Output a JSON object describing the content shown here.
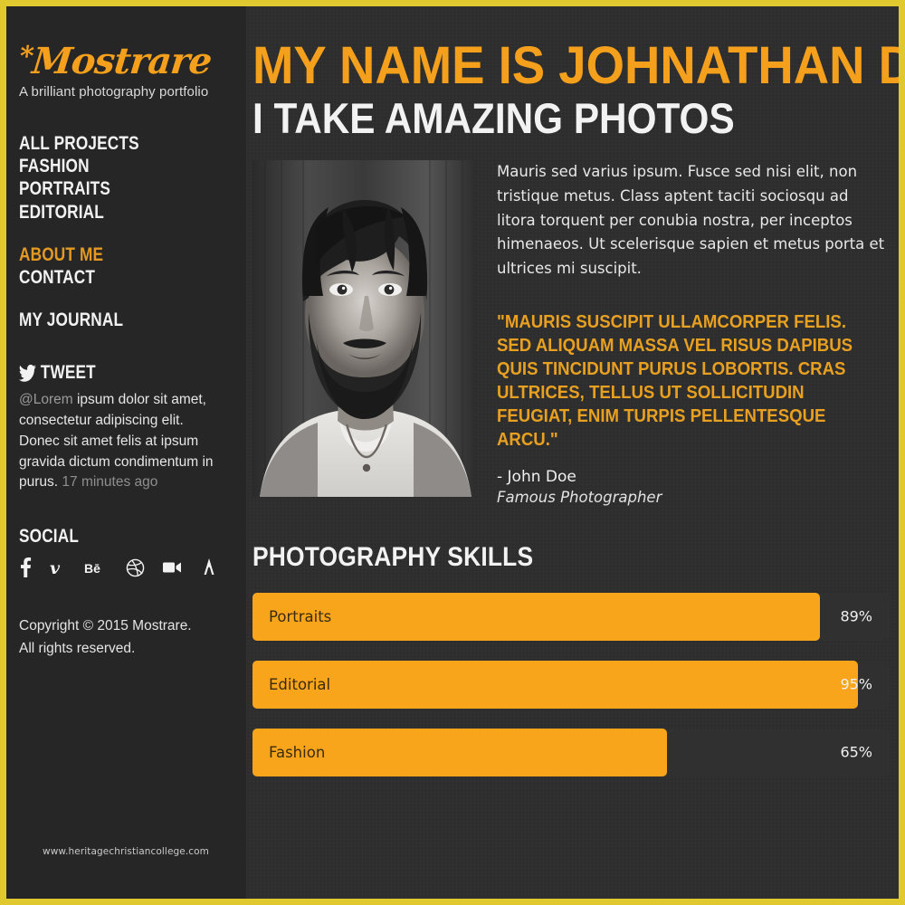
{
  "brand": {
    "logo_star": "*",
    "logo_text": "Mostrare",
    "tagline": "A brilliant photography portfolio"
  },
  "sidebar": {
    "nav_groups": [
      {
        "items": [
          {
            "label": "ALL PROJECTS",
            "active": false
          },
          {
            "label": "FASHION",
            "active": false
          },
          {
            "label": "PORTRAITS",
            "active": false
          },
          {
            "label": "EDITORIAL",
            "active": false
          }
        ]
      },
      {
        "items": [
          {
            "label": "ABOUT ME",
            "active": true
          },
          {
            "label": "CONTACT",
            "active": false
          }
        ]
      },
      {
        "items": [
          {
            "label": "MY JOURNAL",
            "active": false
          }
        ]
      }
    ],
    "tweet": {
      "heading": "TWEET",
      "icon": "twitter-bird-icon",
      "handle": "@Lorem",
      "text": " ipsum dolor sit amet, consectetur adipiscing elit. Donec sit amet felis at ipsum gravida dictum condimentum in purus. ",
      "timestamp": "17 minutes ago"
    },
    "social": {
      "heading": "SOCIAL",
      "icons": [
        {
          "name": "facebook-icon",
          "glyph": "f"
        },
        {
          "name": "vimeo-icon",
          "glyph": "v"
        },
        {
          "name": "behance-icon",
          "glyph": "Bē"
        },
        {
          "name": "dribbble-icon",
          "glyph": "ball"
        },
        {
          "name": "vine-video-icon",
          "glyph": "video"
        },
        {
          "name": "forrst-icon",
          "glyph": "tree"
        }
      ]
    },
    "copyright_line1": "Copyright © 2015 Mostrare.",
    "copyright_line2": "All rights reserved.",
    "watermark": "www.heritagechristiancollege.com"
  },
  "hero": {
    "title": "MY NAME IS JOHNATHAN DOE",
    "subtitle": "I TAKE AMAZING PHOTOS"
  },
  "about": {
    "photo_alt": "black and white portrait of bearded man",
    "paragraph": "Mauris sed varius ipsum. Fusce sed nisi elit, non tristique metus. Class aptent taciti sociosqu ad litora torquent per conubia nostra, per inceptos himenaeos. Ut scelerisque sapien et metus porta et ultrices mi suscipit.",
    "quote": "\"MAURIS SUSCIPIT ULLAMCORPER FELIS. SED ALIQUAM MASSA VEL RISUS DAPIBUS QUIS TINCIDUNT PURUS LOBORTIS. CRAS ULTRICES, TELLUS UT SOLLICITUDIN FEUGIAT, ENIM TURPIS PELLENTESQUE ARCU.\"",
    "cite_name": "- John Doe",
    "cite_role": "Famous Photographer"
  },
  "skills": {
    "heading": "PHOTOGRAPHY SKILLS",
    "items": [
      {
        "label": "Portraits",
        "percent_label": "89%",
        "percent": 89
      },
      {
        "label": "Editorial",
        "percent_label": "95%",
        "percent": 95
      },
      {
        "label": "Fashion",
        "percent_label": "65%",
        "percent": 65
      }
    ]
  },
  "colors": {
    "accent_orange": "#f9a51c",
    "logo_orange": "#f4a01d",
    "border_gold": "#e0c92f",
    "sidebar_bg": "#262626",
    "main_bg": "#2d2d2d"
  }
}
